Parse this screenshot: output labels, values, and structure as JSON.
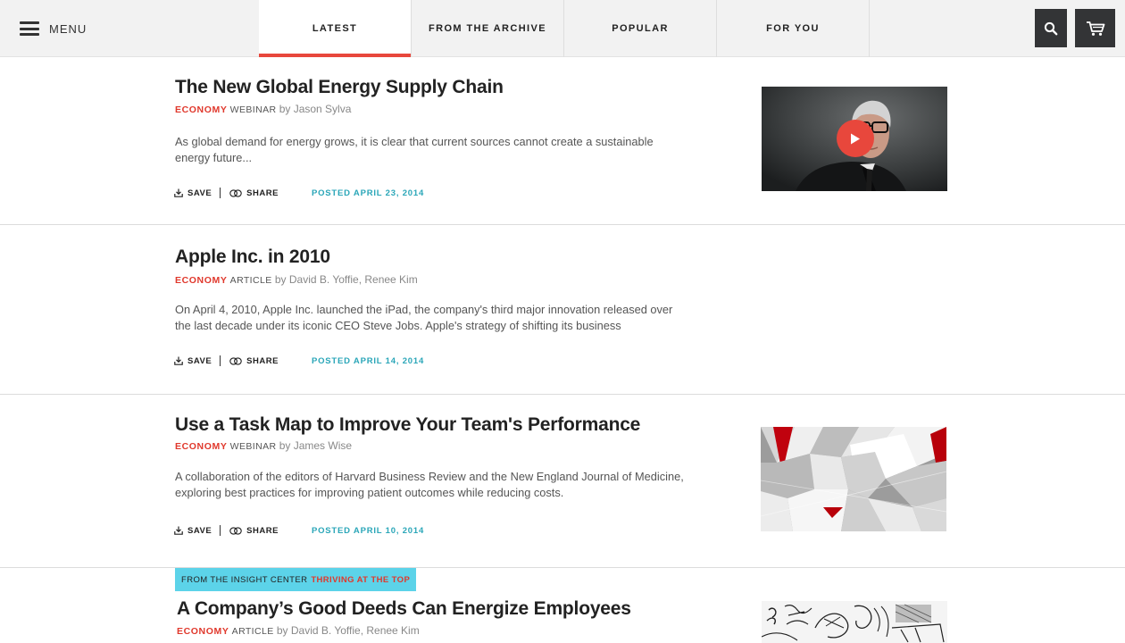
{
  "nav": {
    "menu_label": "MENU",
    "tabs": [
      {
        "label": "LATEST",
        "active": true
      },
      {
        "label": "FROM THE ARCHIVE",
        "active": false
      },
      {
        "label": "POPULAR",
        "active": false
      },
      {
        "label": "FOR YOU",
        "active": false
      }
    ],
    "accent_color": "#e8473c",
    "search_icon": "search-icon",
    "cart_icon": "cart-icon"
  },
  "actions": {
    "save_label": "SAVE",
    "share_label": "SHARE",
    "posted_prefix": "POSTED"
  },
  "articles": [
    {
      "title": "The New Global Energy Supply Chain",
      "topic": "ECONOMY",
      "type": "WEBINAR",
      "byline": "by Jason Sylva",
      "summary": "As global demand for energy grows, it is clear that current sources cannot create a sustainable energy future...",
      "posted_date": "APRIL 23, 2014",
      "thumbnail": "video-thumbnail-man-in-suit",
      "has_play_button": true
    },
    {
      "title": "Apple Inc. in 2010",
      "topic": "ECONOMY",
      "type": "ARTICLE",
      "byline": "by David B. Yoffie, Renee Kim",
      "summary": "On April 4, 2010, Apple Inc. launched the iPad, the company's third major innovation released over the last decade under its iconic CEO Steve Jobs. Apple's strategy of shifting its business",
      "posted_date": "APRIL 14, 2014"
    },
    {
      "title": "Use a Task Map to Improve Your Team's Performance",
      "topic": "ECONOMY",
      "type": "WEBINAR",
      "byline": "by James Wise",
      "summary": "A collaboration of the editors of Harvard Business Review and the New England Journal of Medicine, exploring best practices for improving patient outcomes while reducing costs.",
      "posted_date": "APRIL 10, 2014",
      "thumbnail": "geometric-paper-pattern-thumbnail"
    },
    {
      "insight_prefix": "FROM THE INSIGHT CENTER",
      "insight_highlight": "THRIVING AT THE TOP",
      "title": "A Company’s Good Deeds Can Energize Employees",
      "topic": "ECONOMY",
      "type": "ARTICLE",
      "byline": "by David B. Yoffie, Renee Kim",
      "thumbnail": "sketch-illustration-thumbnail"
    }
  ],
  "colors": {
    "topic": "#e0382c",
    "posted": "#2aa6b8",
    "insight_bg": "#5cd3e9"
  }
}
